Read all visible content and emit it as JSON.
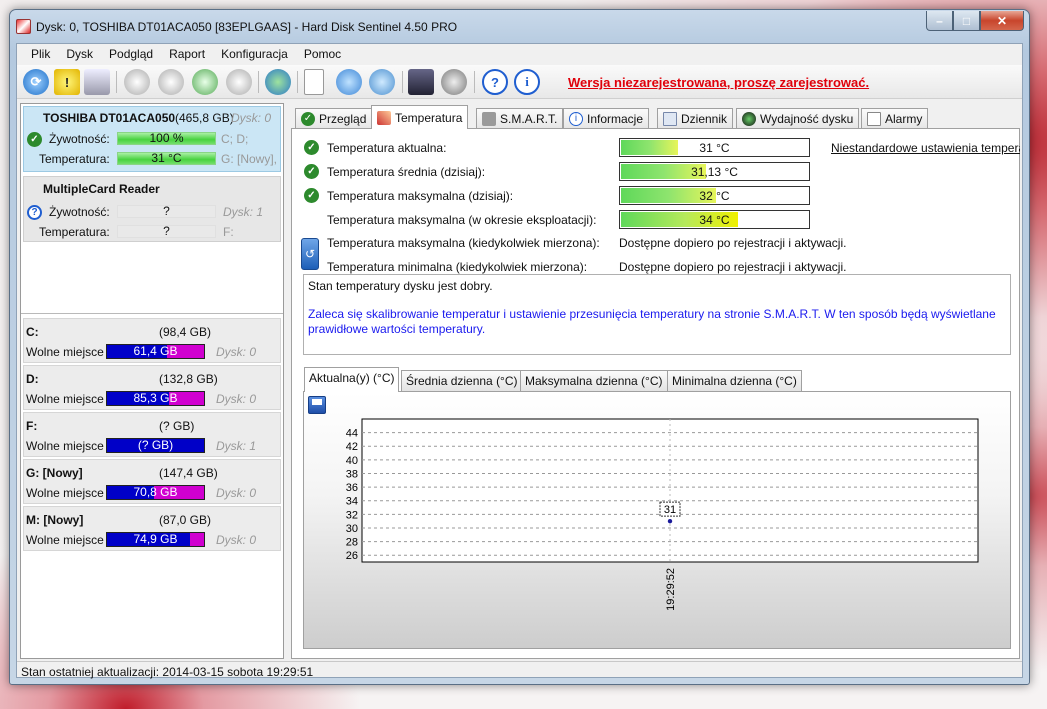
{
  "window": {
    "title": "Dysk: 0, TOSHIBA DT01ACA050 [83EPLGAAS]  -  Hard Disk Sentinel 4.50 PRO",
    "controls": [
      "–",
      "□",
      "✕"
    ]
  },
  "menu": [
    "Plik",
    "Dysk",
    "Podgląd",
    "Raport",
    "Konfiguracja",
    "Pomoc"
  ],
  "toolbar": {
    "register_link": "Wersja niezarejestrowana, proszę zarejestrować."
  },
  "disks": [
    {
      "name": "TOSHIBA DT01ACA050",
      "size": "(465,8 GB)",
      "disk_id": "Dysk: 0",
      "health_label": "Żywotność:",
      "health_value": "100 %",
      "health_drives": "C; D;",
      "temp_label": "Temperatura:",
      "temp_value": "31 °C",
      "temp_drives": "G: [Nowy],"
    },
    {
      "name": "MultipleCard  Reader",
      "health_label": "Żywotność:",
      "health_value": "?",
      "health_drives": "Dysk: 1",
      "temp_label": "Temperatura:",
      "temp_value": "?",
      "temp_drives": "F:"
    }
  ],
  "volumes": [
    {
      "letter": "C:",
      "size": "(98,4 GB)",
      "free_label": "Wolne miejsce",
      "free": "61,4 GB",
      "disk": "Dysk: 0",
      "fill_pct": 62,
      "color": "#d000d0"
    },
    {
      "letter": "D:",
      "size": "(132,8 GB)",
      "free_label": "Wolne miejsce",
      "free": "85,3 GB",
      "disk": "Dysk: 0",
      "fill_pct": 64,
      "color": "#d000d0"
    },
    {
      "letter": "F:",
      "size": "(? GB)",
      "free_label": "Wolne miejsce",
      "free": "(? GB)",
      "disk": "Dysk: 1",
      "fill_pct": 100,
      "color": "#0000c8"
    },
    {
      "letter": "G: [Nowy]",
      "size": "(147,4 GB)",
      "free_label": "Wolne miejsce",
      "free": "70,8 GB",
      "disk": "Dysk: 0",
      "fill_pct": 48,
      "color": "#d000d0"
    },
    {
      "letter": "M: [Nowy]",
      "size": "(87,0 GB)",
      "free_label": "Wolne miejsce",
      "free": "74,9 GB",
      "disk": "Dysk: 0",
      "fill_pct": 86,
      "color": "#d000d0"
    }
  ],
  "tabs": [
    "Przegląd",
    "Temperatura",
    "S.M.A.R.T.",
    "Informacje",
    "Dziennik",
    "Wydajność dysku",
    "Alarmy"
  ],
  "temperature": {
    "rows": [
      {
        "label": "Temperatura aktualna:",
        "value": "31 °C",
        "fill": 0.3
      },
      {
        "label": "Temperatura średnia (dzisiaj):",
        "value": "31,13 °C",
        "fill": 0.45
      },
      {
        "label": "Temperatura maksymalna (dzisiaj):",
        "value": "32 °C",
        "fill": 0.5
      },
      {
        "label": "Temperatura maksymalna (w okresie eksploatacji):",
        "value": "34 °C",
        "fill": 0.62
      }
    ],
    "custom_link": "Niestandardowe ustawienia temperatury",
    "info_rows": [
      {
        "label": "Temperatura maksymalna (kiedykolwiek mierzona):",
        "value": "Dostępne dopiero po rejestracji i aktywacji."
      },
      {
        "label": "Temperatura minimalna (kiedykolwiek mierzona):",
        "value": "Dostępne dopiero po rejestracji i aktywacji."
      }
    ],
    "status_text": "Stan temperatury dysku jest dobry.",
    "advice_text": "Zaleca się skalibrowanie temperatur i ustawienie przesunięcia temperatury na stronie S.M.A.R.T. W ten sposób będą wyświetlane prawidłowe wartości temperatury."
  },
  "chart_tabs": [
    "Aktualna(y) (°C)",
    "Średnia dzienna (°C)",
    "Maksymalna dzienna (°C)",
    "Minimalna dzienna (°C)"
  ],
  "chart_data": {
    "type": "line",
    "y_ticks": [
      44,
      42,
      40,
      38,
      36,
      34,
      32,
      30,
      28,
      26
    ],
    "ylim": [
      25,
      46
    ],
    "x": [
      "19:29:52"
    ],
    "values": [
      31
    ],
    "point_label": "31",
    "grid": true
  },
  "statusbar": "Stan ostatniej aktualizacji: 2014-03-15 sobota 19:29:51"
}
